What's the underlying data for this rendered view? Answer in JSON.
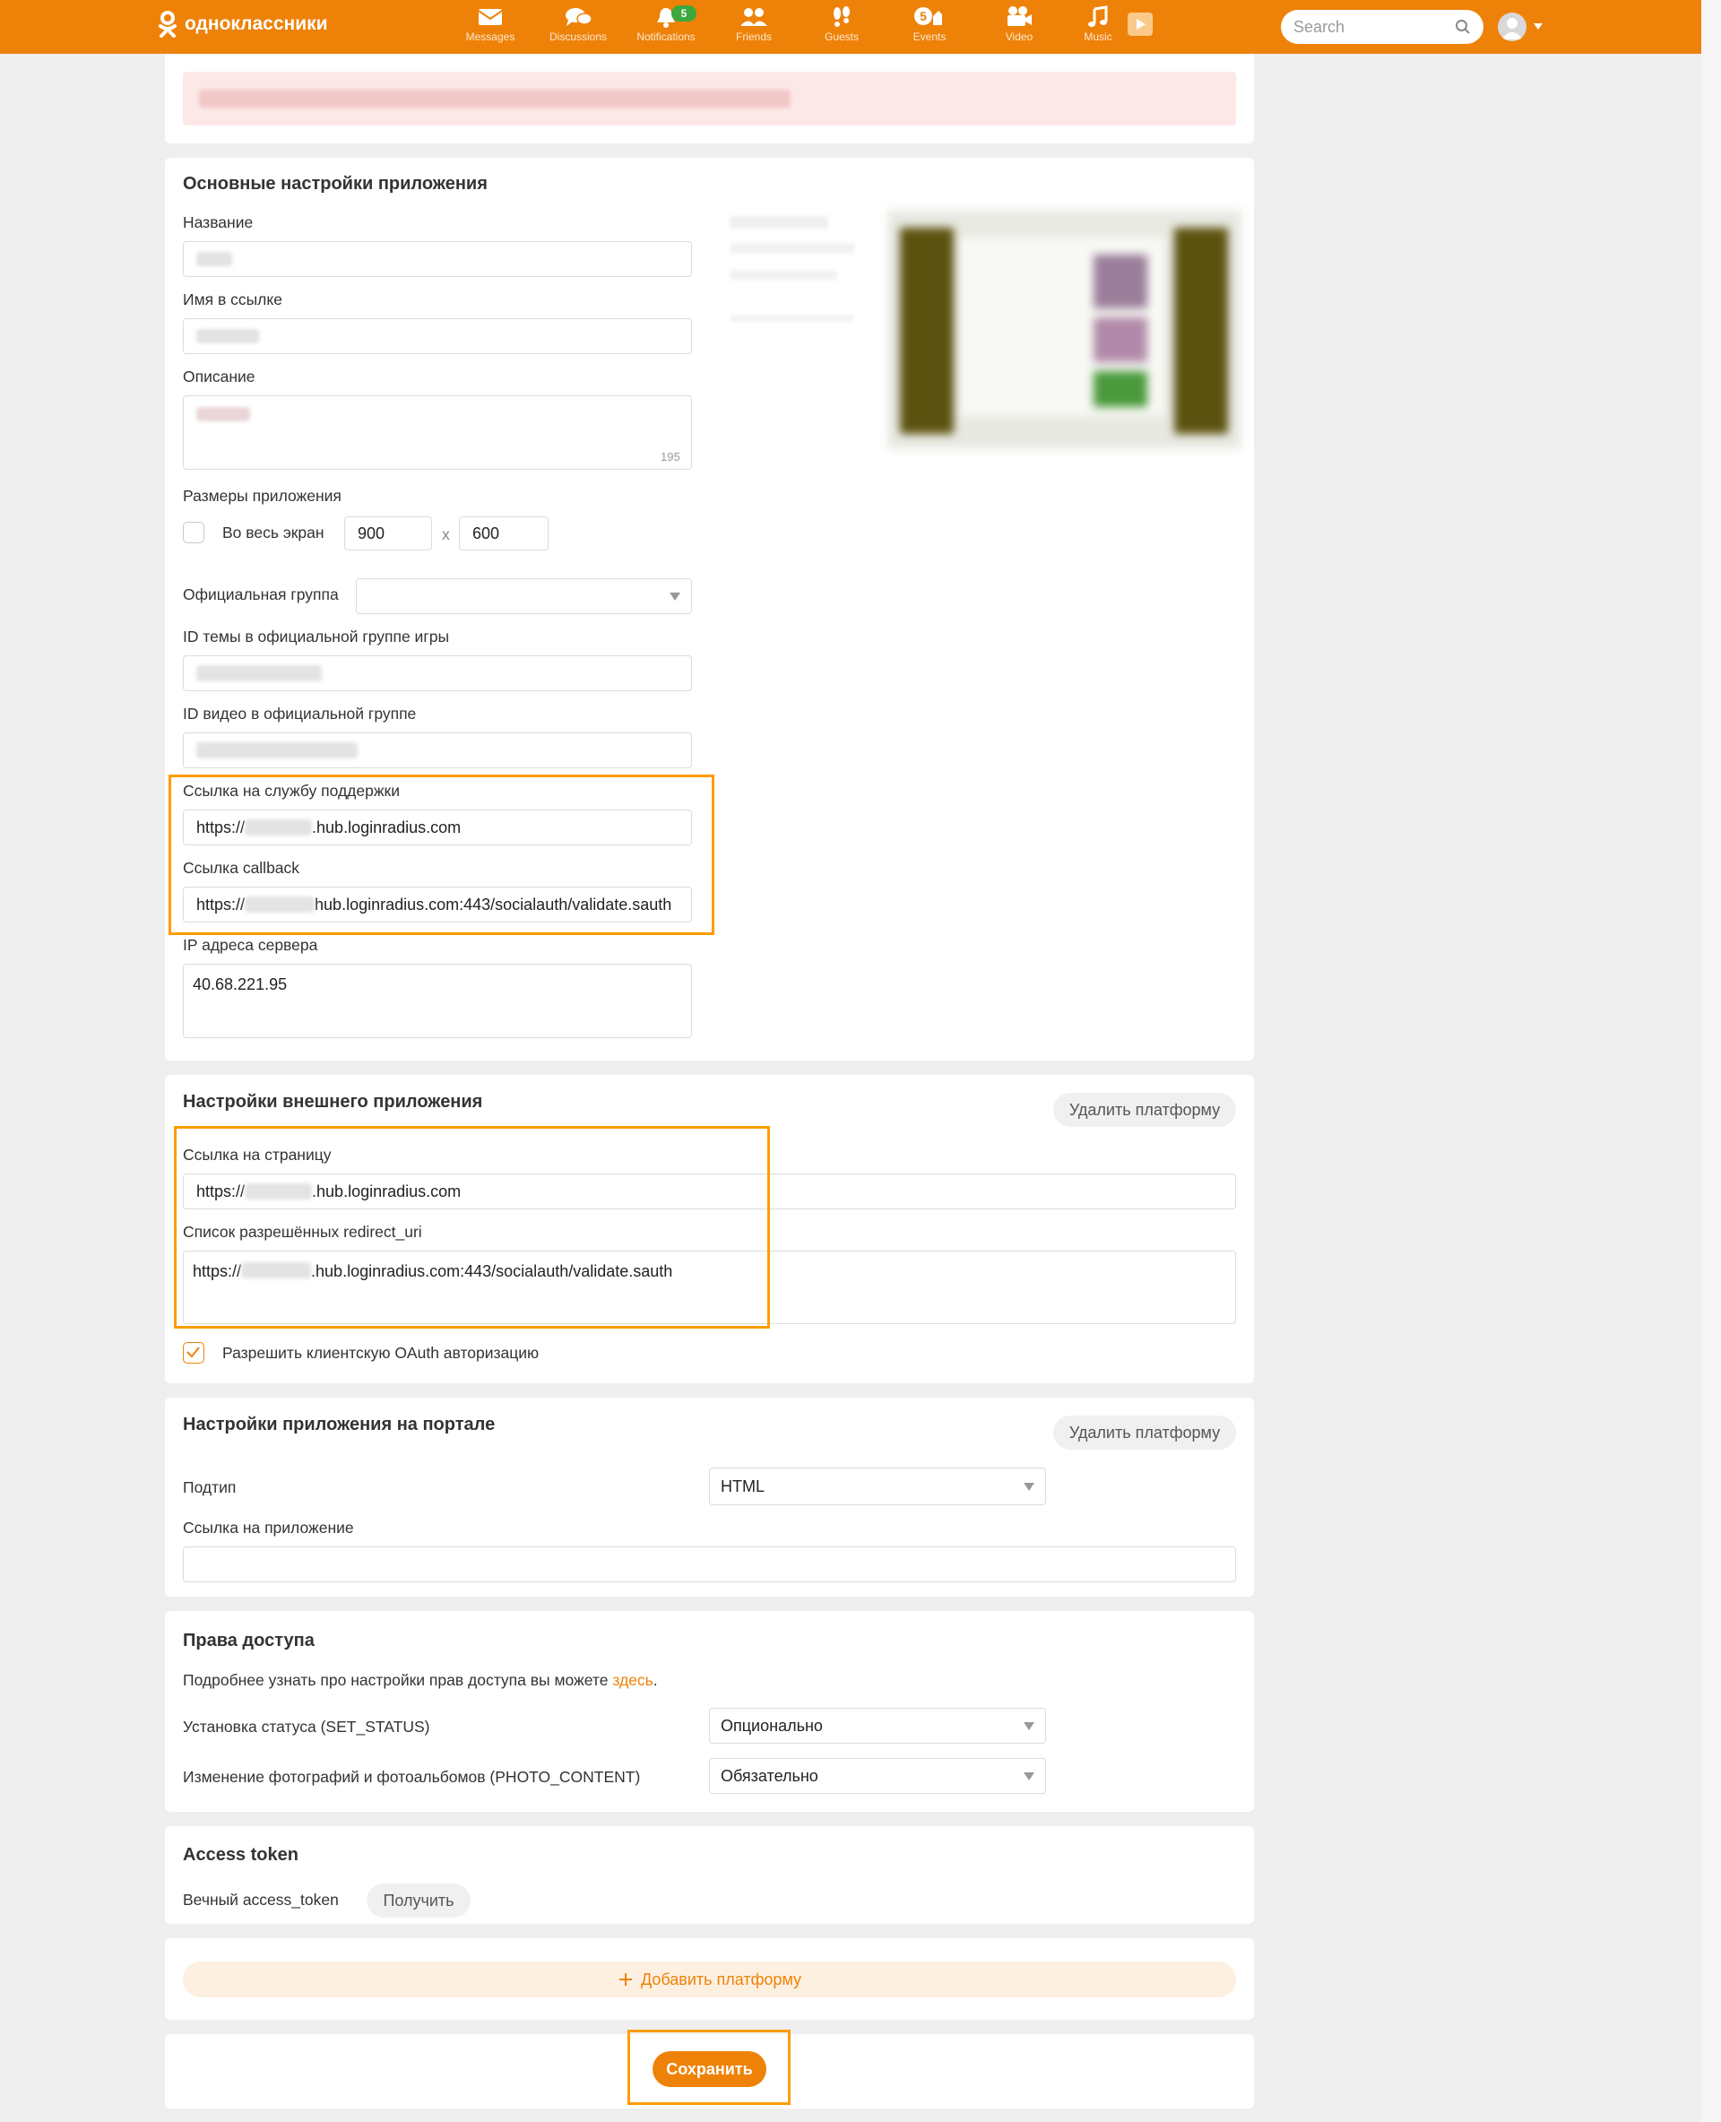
{
  "header": {
    "logo_text": "одноклассники",
    "nav": [
      {
        "label": "Messages",
        "icon": "envelope-icon"
      },
      {
        "label": "Discussions",
        "icon": "chat-bubbles-icon"
      },
      {
        "label": "Notifications",
        "icon": "bell-icon",
        "badge": "5"
      },
      {
        "label": "Friends",
        "icon": "friends-icon"
      },
      {
        "label": "Guests",
        "icon": "footprints-icon"
      },
      {
        "label": "Events",
        "icon": "events-icon",
        "badge_inline": "5"
      },
      {
        "label": "Video",
        "icon": "video-camera-icon"
      },
      {
        "label": "Music",
        "icon": "music-note-icon"
      }
    ],
    "search_placeholder": "Search"
  },
  "basic": {
    "title": "Основные настройки приложения",
    "name_label": "Название",
    "link_name_label": "Имя в ссылке",
    "description_label": "Описание",
    "description_counter": "195",
    "sizes_label": "Размеры приложения",
    "fullscreen_label": "Во весь экран",
    "width_value": "900",
    "size_separator": "x",
    "height_value": "600",
    "official_group_label": "Официальная группа",
    "topic_id_label": "ID темы в официальной группе игры",
    "video_id_label": "ID видео в официальной группе",
    "support_link_label": "Ссылка на службу поддержки",
    "support_link_prefix": "https://",
    "support_link_suffix": ".hub.loginradius.com",
    "callback_label": "Ссылка callback",
    "callback_prefix": "https://",
    "callback_suffix": "hub.loginradius.com:443/socialauth/validate.sauth",
    "ip_label": "IP адреса сервера",
    "ip_value": "40.68.221.95"
  },
  "external": {
    "title": "Настройки внешнего приложения",
    "delete_button": "Удалить платформу",
    "page_link_label": "Ссылка на страницу",
    "page_link_prefix": "https://",
    "page_link_suffix": ".hub.loginradius.com",
    "redirect_label": "Список разрешённых redirect_uri",
    "redirect_prefix": "https://",
    "redirect_suffix": ".hub.loginradius.com:443/socialauth/validate.sauth",
    "oauth_checkbox_label": "Разрешить клиентскую OAuth авторизацию",
    "oauth_checked": true
  },
  "portal": {
    "title": "Настройки приложения на портале",
    "delete_button": "Удалить платформу",
    "subtype_label": "Подтип",
    "subtype_value": "HTML",
    "app_link_label": "Ссылка на приложение"
  },
  "access": {
    "title": "Права доступа",
    "info_text": "Подробнее узнать про настройки прав доступа вы можете ",
    "info_link": "здесь",
    "info_end": ".",
    "set_status_label": "Установка статуса (SET_STATUS)",
    "set_status_value": "Опционально",
    "photo_label": "Изменение фотографий и фотоальбомов (PHOTO_CONTENT)",
    "photo_value": "Обязательно"
  },
  "token": {
    "title": "Access token",
    "eternal_label": "Вечный access_token",
    "get_button": "Получить"
  },
  "add_platform": {
    "icon": "plus-icon",
    "label": "Добавить платформу"
  },
  "save_button": "Сохранить",
  "colors": {
    "brand": "#ee8208",
    "highlight": "#ff9c00",
    "badge": "#3da83d",
    "error_banner": "#fde8e8"
  }
}
